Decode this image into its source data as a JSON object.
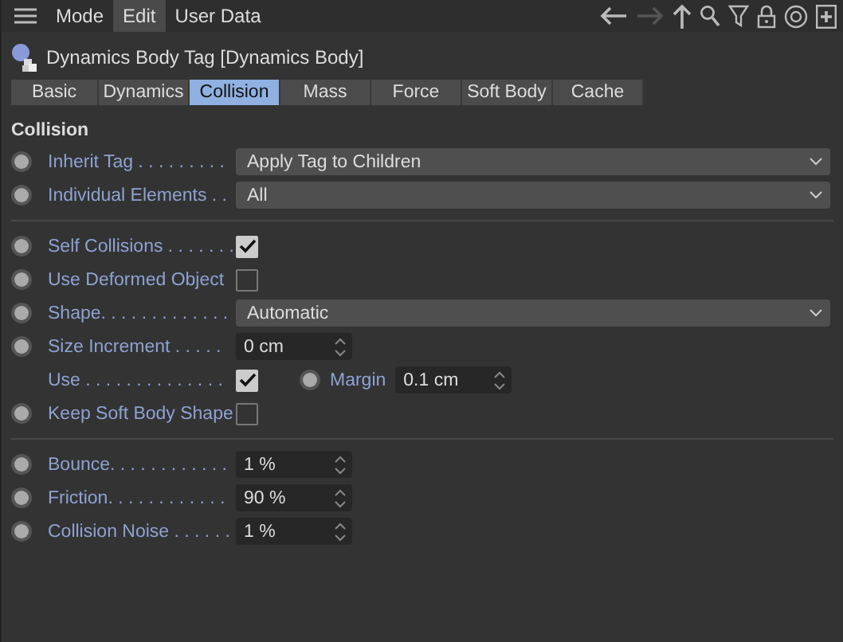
{
  "menu": [
    {
      "label": "Mode",
      "selected": false
    },
    {
      "label": "Edit",
      "selected": true
    },
    {
      "label": "User Data",
      "selected": false
    }
  ],
  "title": "Dynamics Body Tag [Dynamics Body]",
  "tabs": [
    {
      "label": "Basic",
      "selected": false
    },
    {
      "label": "Dynamics",
      "selected": false
    },
    {
      "label": "Collision",
      "selected": true
    },
    {
      "label": "Mass",
      "selected": false
    },
    {
      "label": "Force",
      "selected": false
    },
    {
      "label": "Soft Body",
      "selected": false
    },
    {
      "label": "Cache",
      "selected": false
    }
  ],
  "heading": "Collision",
  "groups": [
    [
      {
        "kind": "dropdown",
        "keyframe_dot": true,
        "label": "Inherit Tag . . . . . . . . .",
        "value": "Apply Tag to Children"
      },
      {
        "kind": "dropdown",
        "keyframe_dot": true,
        "label": "Individual Elements . .",
        "value": "All"
      }
    ],
    [
      {
        "kind": "checkbox",
        "keyframe_dot": true,
        "label": "Self Collisions . . . . . . .",
        "checked": true
      },
      {
        "kind": "checkbox",
        "keyframe_dot": true,
        "label": "Use Deformed Object",
        "checked": false
      },
      {
        "kind": "dropdown",
        "keyframe_dot": true,
        "label": "Shape. . . . . . . . . . . . .",
        "value": "Automatic"
      },
      {
        "kind": "number",
        "keyframe_dot": true,
        "label": "Size Increment  . . . . .",
        "value": "0 cm"
      },
      {
        "kind": "checkbox_margin",
        "keyframe_dot": false,
        "label": "Use . . . . . . . . . . . . . .",
        "checked": true,
        "margin_label": "Margin",
        "margin_value": "0.1 cm"
      },
      {
        "kind": "checkbox",
        "keyframe_dot": true,
        "label": "Keep Soft Body Shape",
        "checked": false
      }
    ],
    [
      {
        "kind": "number",
        "keyframe_dot": true,
        "label": "Bounce. . . . . . . . . . . .",
        "value": "1 %"
      },
      {
        "kind": "number",
        "keyframe_dot": true,
        "label": "Friction. . . . . . . . . . . .",
        "value": "90 %"
      },
      {
        "kind": "number",
        "keyframe_dot": true,
        "label": "Collision Noise  . . . . . .",
        "value": "1 %"
      }
    ]
  ]
}
